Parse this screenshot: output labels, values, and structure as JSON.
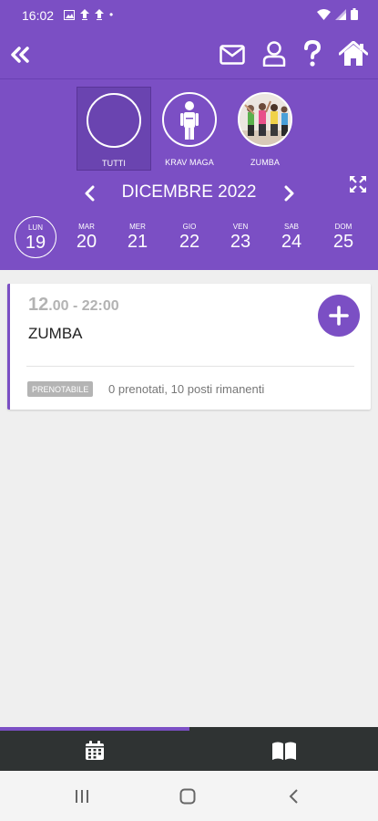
{
  "status_bar": {
    "time": "16:02",
    "dot": "•"
  },
  "app_bar": {
    "back_icon": "double-chevron-left-icon",
    "mail_icon": "mail-icon",
    "user_icon": "user-icon",
    "help_icon": "question-icon",
    "home_icon": "home-icon"
  },
  "activities": [
    {
      "label": "TUTTI",
      "selected": true
    },
    {
      "label": "KRAV MAGA",
      "selected": false
    },
    {
      "label": "ZUMBA",
      "selected": false
    }
  ],
  "calendar": {
    "month": "DICEMBRE 2022",
    "days": [
      {
        "name": "LUN",
        "num": "19"
      },
      {
        "name": "MAR",
        "num": "20"
      },
      {
        "name": "MER",
        "num": "21"
      },
      {
        "name": "GIO",
        "num": "22"
      },
      {
        "name": "VEN",
        "num": "23"
      },
      {
        "name": "SAB",
        "num": "24"
      },
      {
        "name": "DOM",
        "num": "25"
      }
    ],
    "active_day": "19"
  },
  "classes": [
    {
      "time_start_big": "12",
      "time_rest": ".00 - 22:00",
      "title": "ZUMBA",
      "badge": "PRENOTABILE",
      "availability": "0 prenotati, 10 posti rimanenti"
    }
  ],
  "colors": {
    "primary": "#7b4fc4",
    "bottom_nav": "#2f3333"
  },
  "bottom_nav": {
    "items": [
      "calendar-icon",
      "book-icon"
    ],
    "active": "calendar-icon"
  }
}
